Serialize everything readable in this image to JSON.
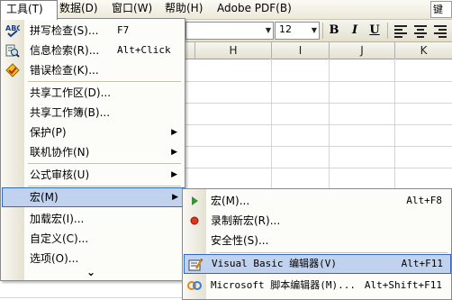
{
  "menubar": {
    "items": [
      "工具(T)",
      "数据(D)",
      "窗口(W)",
      "帮助(H)",
      "Adobe PDF(B)"
    ],
    "help_box": "键入"
  },
  "toolbar": {
    "font_size": "12",
    "bold": "B",
    "italic": "I",
    "underline": "U"
  },
  "columns": [
    "H",
    "I",
    "J",
    "K"
  ],
  "tools_menu": {
    "items": [
      {
        "label": "拼写检查(S)...",
        "shortcut": "F7",
        "icon": "spelling-icon"
      },
      {
        "label": "信息检索(R)...",
        "shortcut": "Alt+Click",
        "icon": "research-icon"
      },
      {
        "label": "错误检查(K)...",
        "icon": "error-check-icon"
      },
      {
        "label": "共享工作区(D)..."
      },
      {
        "label": "共享工作簿(B)..."
      },
      {
        "label": "保护(P)",
        "submenu": true
      },
      {
        "label": "联机协作(N)",
        "submenu": true
      },
      {
        "label": "公式审核(U)",
        "submenu": true
      },
      {
        "label": "宏(M)",
        "submenu": true
      },
      {
        "label": "加载宏(I)..."
      },
      {
        "label": "自定义(C)..."
      },
      {
        "label": "选项(O)..."
      }
    ],
    "expand_glyph": "⌄"
  },
  "macro_menu": {
    "items": [
      {
        "label": "宏(M)...",
        "shortcut": "Alt+F8",
        "icon": "run-macro-icon"
      },
      {
        "label": "录制新宏(R)...",
        "icon": "record-icon"
      },
      {
        "label": "安全性(S)..."
      },
      {
        "label": "Visual Basic 编辑器(V)",
        "shortcut": "Alt+F11",
        "icon": "vb-editor-icon"
      },
      {
        "label": "Microsoft 脚本编辑器(M)...",
        "shortcut": "Alt+Shift+F11",
        "icon": "script-editor-icon"
      }
    ]
  },
  "colors": {
    "highlight_bg": "#c1d2ee",
    "highlight_border": "#316ac5",
    "menu_bg": "#fcfcf9",
    "toolbar_bg": "#ece9d8"
  }
}
